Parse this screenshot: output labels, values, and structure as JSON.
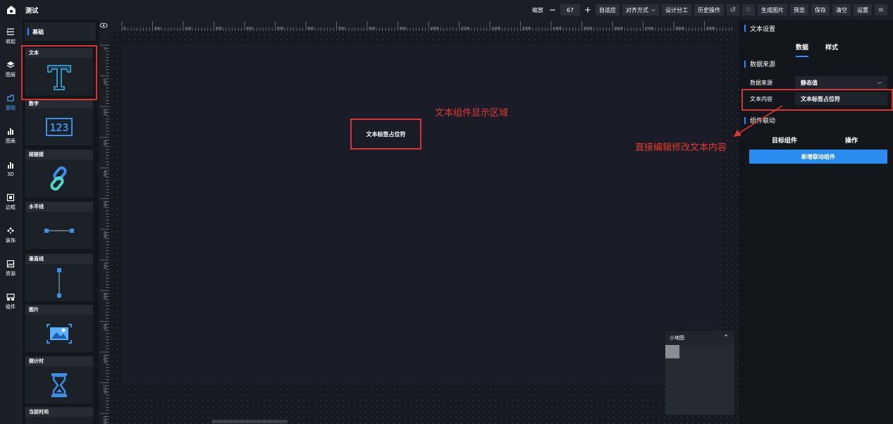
{
  "app": {
    "title": "测试"
  },
  "toolbar": {
    "zoom_label": "缩放",
    "zoom_minus": "−",
    "zoom_value": "67",
    "zoom_plus": "+",
    "fit": "自适应",
    "align": "对齐方式",
    "design": "设计分工",
    "history": "历史操作",
    "undo_icon": "↺",
    "redo_icon": "↻",
    "generate_image": "生成图片",
    "preview": "预览",
    "save": "保存",
    "clear": "清空",
    "settings": "设置",
    "menu_icon": "≡"
  },
  "nav": {
    "items": [
      {
        "label": "收起",
        "icon": "collapse-icon"
      },
      {
        "label": "图层",
        "icon": "layers-icon"
      },
      {
        "label": "基础",
        "icon": "basic-icon"
      },
      {
        "label": "图表",
        "icon": "chart-icon"
      },
      {
        "label": "3D",
        "icon": "3d-icon"
      },
      {
        "label": "边框",
        "icon": "border-icon"
      },
      {
        "label": "装饰",
        "icon": "decoration-icon"
      },
      {
        "label": "资源",
        "icon": "resource-icon"
      },
      {
        "label": "组件",
        "icon": "component-icon"
      }
    ]
  },
  "component_panel": {
    "title": "基础",
    "items": [
      {
        "label": "文本"
      },
      {
        "label": "数字"
      },
      {
        "label": "超链接"
      },
      {
        "label": "水平线"
      },
      {
        "label": "垂直线"
      },
      {
        "label": "图片"
      },
      {
        "label": "倒计时"
      },
      {
        "label": "当前时间"
      }
    ]
  },
  "ruler": {
    "top_ticks": [
      "0",
      "100",
      "200",
      "300",
      "400",
      "500",
      "600",
      "700",
      "800",
      "900",
      "1000",
      "1100",
      "1200",
      "1300",
      "1400",
      "1500",
      "1600",
      "1700",
      "1800",
      "1900"
    ],
    "left_ticks": [
      "0",
      "100",
      "200",
      "300",
      "400",
      "500",
      "600",
      "700",
      "800",
      "900",
      "1000",
      "1100",
      "1200"
    ]
  },
  "canvas": {
    "text_component": "文本标签占位符"
  },
  "minimap": {
    "title": "小地图"
  },
  "settings_panel": {
    "title": "文本设置",
    "tabs": [
      "数据",
      "样式"
    ],
    "data_source_section": "数据来源",
    "data_source_label": "数据来源",
    "data_source_value": "静态值",
    "text_content_label": "文本内容",
    "text_content_value": "文本标签占位符",
    "link_section": "组件联动",
    "col_target": "目标组件",
    "col_action": "操作",
    "add_link_button": "新增联动组件"
  },
  "annotations": {
    "display_area": "文本组件显示区域",
    "edit_hint": "直接编辑修改文本内容"
  },
  "colors": {
    "accent": "#2e8cff",
    "annotation_red": "#d93430",
    "button_blue": "#2b8cf0"
  }
}
